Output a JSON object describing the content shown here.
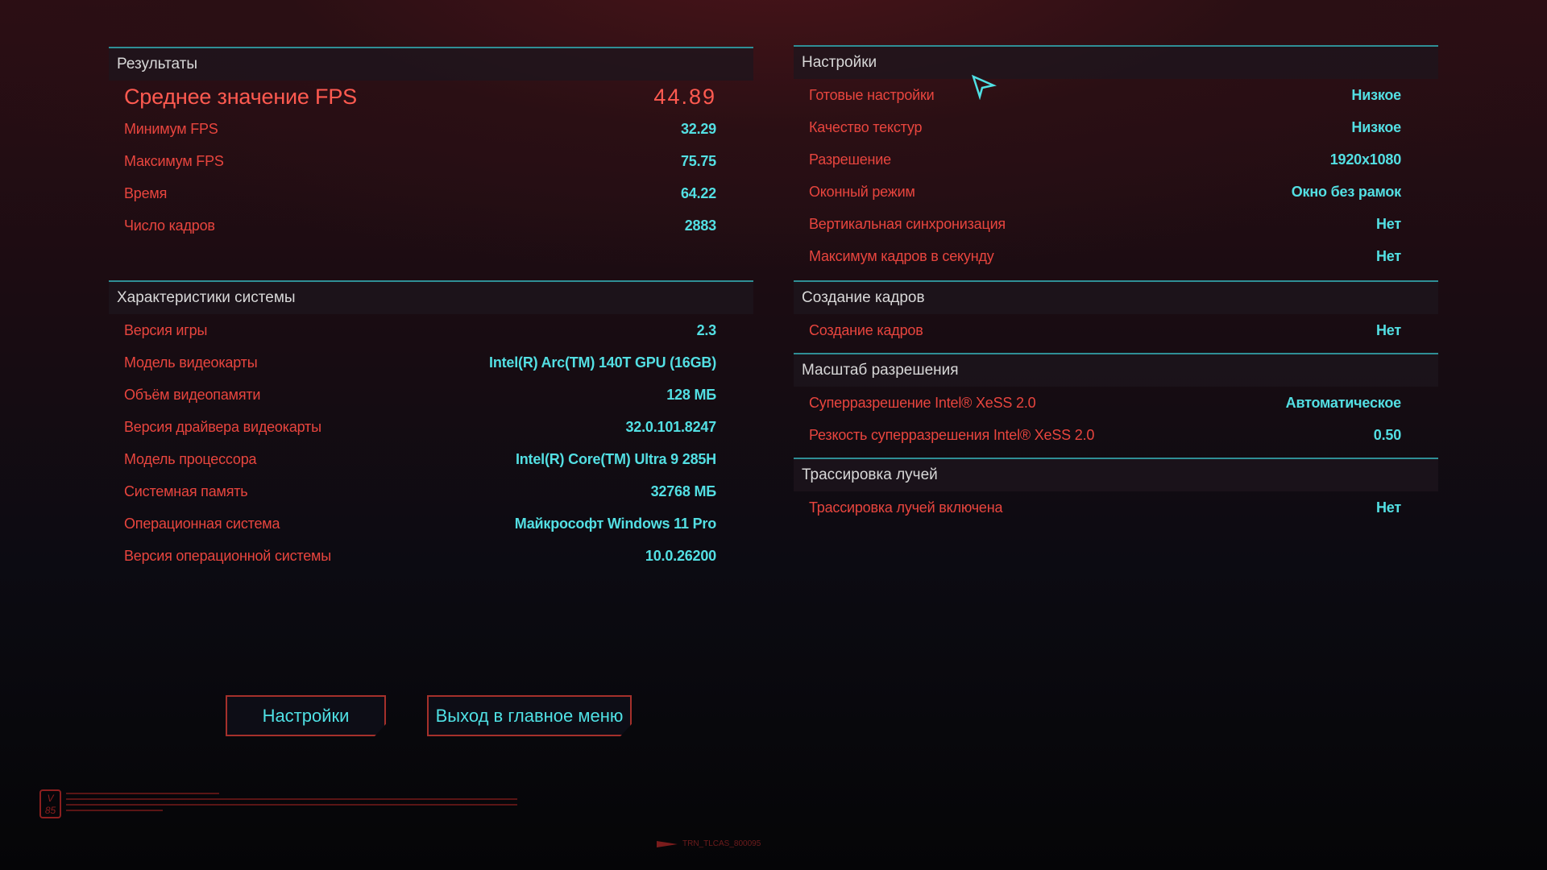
{
  "results": {
    "title": "Результаты",
    "rows": [
      {
        "label": "Среднее значение FPS",
        "value": "44.89"
      },
      {
        "label": "Минимум FPS",
        "value": "32.29"
      },
      {
        "label": "Максимум FPS",
        "value": "75.75"
      },
      {
        "label": "Время",
        "value": "64.22"
      },
      {
        "label": "Число кадров",
        "value": "2883"
      }
    ]
  },
  "system": {
    "title": "Характеристики системы",
    "rows": [
      {
        "label": "Версия игры",
        "value": "2.3"
      },
      {
        "label": "Модель видеокарты",
        "value": "Intel(R) Arc(TM) 140T GPU (16GB)"
      },
      {
        "label": "Объём видеопамяти",
        "value": "128 МБ"
      },
      {
        "label": "Версия драйвера видеокарты",
        "value": "32.0.101.8247"
      },
      {
        "label": "Модель процессора",
        "value": "Intel(R) Core(TM) Ultra 9 285H"
      },
      {
        "label": "Системная память",
        "value": "32768 МБ"
      },
      {
        "label": "Операционная система",
        "value": "Майкрософт Windows 11 Pro"
      },
      {
        "label": "Версия операционной системы",
        "value": "10.0.26200"
      }
    ]
  },
  "settings": {
    "title": "Настройки",
    "rows": [
      {
        "label": "Готовые настройки",
        "value": "Низкое"
      },
      {
        "label": "Качество текстур",
        "value": "Низкое"
      },
      {
        "label": "Разрешение",
        "value": "1920x1080"
      },
      {
        "label": "Оконный режим",
        "value": "Окно без рамок"
      },
      {
        "label": "Вертикальная синхронизация",
        "value": "Нет"
      },
      {
        "label": "Максимум кадров в секунду",
        "value": "Нет"
      }
    ]
  },
  "frame_gen": {
    "title": "Создание кадров",
    "rows": [
      {
        "label": "Создание кадров",
        "value": "Нет"
      }
    ]
  },
  "scaling": {
    "title": "Масштаб разрешения",
    "rows": [
      {
        "label": "Суперразрешение Intel® XeSS 2.0",
        "value": "Автоматическое"
      },
      {
        "label": "Резкость суперразрешения Intel® XeSS 2.0",
        "value": "0.50"
      }
    ]
  },
  "raytracing": {
    "title": "Трассировка лучей",
    "rows": [
      {
        "label": "Трассировка лучей включена",
        "value": "Нет"
      }
    ]
  },
  "buttons": {
    "settings": "Настройки",
    "exit": "Выход в главное меню"
  },
  "footer": {
    "logo": "V 85",
    "code": "TRN_TLCAS_800095"
  },
  "colors": {
    "label": "#e8453e",
    "value": "#53dfe3",
    "accent_line": "#2f8f96",
    "button_border": "#a5302b"
  }
}
